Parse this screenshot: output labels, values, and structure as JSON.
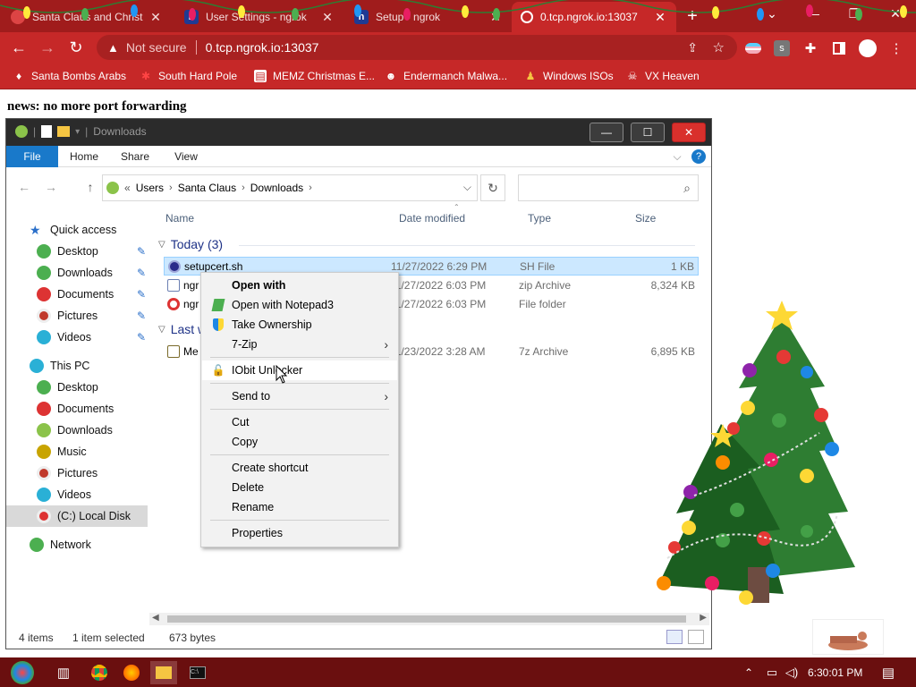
{
  "browser": {
    "tabs": [
      {
        "title": "Santa Claus and Christ",
        "close": "✕"
      },
      {
        "title": "User Settings - ngrok",
        "favicon": "n",
        "close": "✕"
      },
      {
        "title": "Setup - ngrok",
        "favicon": "n",
        "close": "✕"
      },
      {
        "title": "0.tcp.ngrok.io:13037",
        "close": "✕"
      }
    ],
    "new_tab": "+",
    "window_controls": {
      "minimize": "—",
      "restore": "❐",
      "close": "✕",
      "menu": "⌄"
    },
    "nav": {
      "back": "←",
      "forward": "→",
      "reload": "↻"
    },
    "omnibox": {
      "warning_icon": "▲",
      "security_text": "Not secure",
      "url": "0.tcp.ngrok.io:13037"
    },
    "toolbar_icons": [
      "share-icon",
      "star-icon",
      "flag-icon",
      "s-extension-icon",
      "puzzle-icon",
      "sidepanel-icon",
      "profile-icon",
      "menu-icon"
    ],
    "bookmarks": [
      {
        "label": "Santa Bombs Arabs"
      },
      {
        "label": "South Hard Pole"
      },
      {
        "label": "MEMZ Christmas E..."
      },
      {
        "label": "Endermanch Malwa..."
      },
      {
        "label": "Windows ISOs"
      },
      {
        "label": "VX Heaven"
      }
    ]
  },
  "page": {
    "headline": "news: no more port forwarding"
  },
  "explorer": {
    "title": "Downloads",
    "ribbon": {
      "file": "File",
      "home": "Home",
      "share": "Share",
      "view": "View",
      "help": "?"
    },
    "address": {
      "prefix": "«",
      "crumbs": [
        "Users",
        "Santa Claus",
        "Downloads"
      ],
      "sep": "›",
      "dropdown": "⌵",
      "refresh": "↻"
    },
    "search_placeholder": "",
    "nav_pane": [
      {
        "label": "Quick access",
        "level": 0,
        "color": "#2a6fc9"
      },
      {
        "label": "Desktop",
        "level": 1,
        "pinned": true,
        "color": "#4caf50"
      },
      {
        "label": "Downloads",
        "level": 1,
        "pinned": true,
        "color": "#4caf50"
      },
      {
        "label": "Documents",
        "level": 1,
        "pinned": true,
        "color": "#d33"
      },
      {
        "label": "Pictures",
        "level": 1,
        "pinned": true,
        "color": "#c0392b"
      },
      {
        "label": "Videos",
        "level": 1,
        "pinned": true,
        "color": "#2ab0d6"
      },
      {
        "label": "This PC",
        "level": 0,
        "color": "#2ab0d6"
      },
      {
        "label": "Desktop",
        "level": 1,
        "color": "#4caf50"
      },
      {
        "label": "Documents",
        "level": 1,
        "color": "#d33"
      },
      {
        "label": "Downloads",
        "level": 1,
        "color": "#8bc34a"
      },
      {
        "label": "Music",
        "level": 1,
        "color": "#c8a400"
      },
      {
        "label": "Pictures",
        "level": 1,
        "color": "#c0392b"
      },
      {
        "label": "Videos",
        "level": 1,
        "color": "#2ab0d6"
      },
      {
        "label": "(C:) Local Disk",
        "level": 1,
        "color": "#d33",
        "selected": true
      },
      {
        "label": "Network",
        "level": 0,
        "color": "#4caf50"
      }
    ],
    "columns": {
      "name": "Name",
      "date": "Date modified",
      "type": "Type",
      "size": "Size"
    },
    "groups": [
      {
        "label": "Today (3)"
      },
      {
        "label": "Last w"
      }
    ],
    "files": [
      {
        "name": "setupcert.sh",
        "date": "11/27/2022 6:29 PM",
        "type": "SH File",
        "size": "1 KB",
        "selected": true,
        "color": "#2a2a8a"
      },
      {
        "name": "ngr",
        "date": "11/27/2022 6:03 PM",
        "type": "zip Archive",
        "size": "8,324 KB",
        "color": "#6b7fb2"
      },
      {
        "name": "ngr",
        "date": "11/27/2022 6:03 PM",
        "type": "File folder",
        "size": "",
        "color": "#d33"
      },
      {
        "name": "Me",
        "date": "11/23/2022 3:28 AM",
        "type": "7z Archive",
        "size": "6,895 KB",
        "color": "#7a6a2a"
      }
    ],
    "status": {
      "items": "4 items",
      "selected": "1 item selected",
      "size": "673 bytes"
    }
  },
  "context_menu": {
    "items": [
      {
        "label": "Open with",
        "bold": true
      },
      {
        "label": "Open with Notepad3",
        "icon": "notepad3-icon"
      },
      {
        "label": "Take Ownership",
        "icon": "shield-icon"
      },
      {
        "label": "7-Zip",
        "submenu": true
      },
      {
        "label": "IObit Unlocker",
        "icon": "lock-icon",
        "hover": true
      },
      {
        "label": "Send to",
        "submenu": true
      },
      {
        "label": "Cut"
      },
      {
        "label": "Copy"
      },
      {
        "label": "Create shortcut"
      },
      {
        "label": "Delete"
      },
      {
        "label": "Rename"
      },
      {
        "label": "Properties"
      }
    ],
    "submenu_arrow": "›"
  },
  "taskbar": {
    "clock": "6:30:01 PM",
    "tray_up": "⌃",
    "apps": [
      "start-icon",
      "task-view-icon",
      "chrome-icon",
      "firefox-icon",
      "explorer-icon",
      "terminal-icon"
    ]
  },
  "popup_close": "✕"
}
